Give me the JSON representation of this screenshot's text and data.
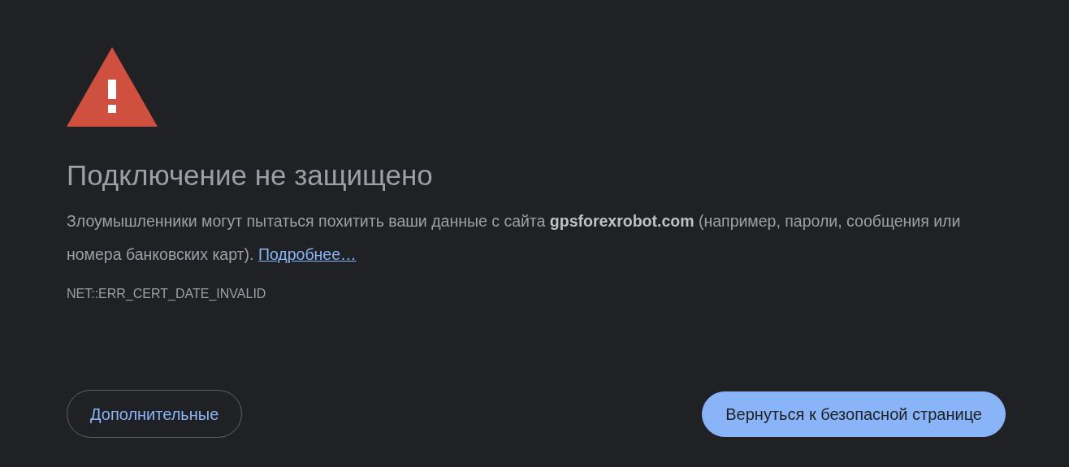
{
  "title": "Подключение не защищено",
  "message": {
    "text": "Злоумышленники могут пытаться похитить ваши данные с сайта **gpsforexrobot.com** (например, пароли, сообщения или номера банковских карт).",
    "link": "Подробнее…"
  },
  "error_code": "NET::ERR_CERT_DATE_INVALID",
  "buttons": [
    {
      "label": "Дополнительные",
      "kind": "secondary"
    },
    {
      "label": "Вернуться к безопасной странице",
      "kind": "primary"
    }
  ]
}
